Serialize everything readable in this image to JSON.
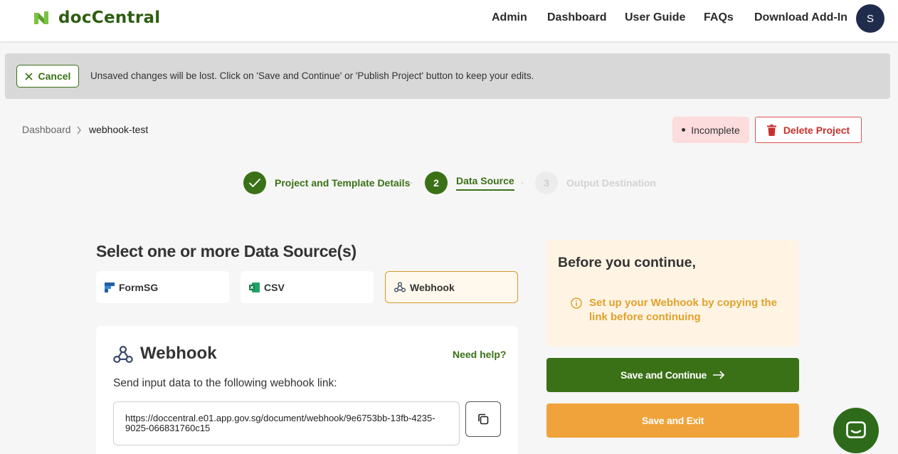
{
  "app": {
    "name": "docCentral",
    "nav": [
      "Admin",
      "Dashboard",
      "User Guide",
      "FAQs",
      "Download Add-In"
    ],
    "user_initial": "S"
  },
  "banner": {
    "cancel_label": "Cancel",
    "message": "Unsaved changes will be lost. Click on 'Save and Continue' or 'Publish Project' button to keep your edits."
  },
  "breadcrumb": {
    "items": [
      "Dashboard",
      "webhook-test"
    ],
    "separator": ">"
  },
  "project": {
    "status": "Incomplete",
    "delete_label": "Delete Project"
  },
  "stepper": {
    "steps": [
      {
        "number": "1",
        "label": "Project and Template Details",
        "state": "done"
      },
      {
        "number": "2",
        "label": "Data Source",
        "state": "active"
      },
      {
        "number": "3",
        "label": "Output Destination",
        "state": "pending"
      }
    ],
    "separator": "-"
  },
  "data_source": {
    "title": "Select one or more Data Source(s)",
    "options": [
      {
        "label": "FormSG",
        "icon": "formsg-icon",
        "selected": false
      },
      {
        "label": "CSV",
        "icon": "excel-icon",
        "selected": false
      },
      {
        "label": "Webhook",
        "icon": "webhook-icon",
        "selected": true
      }
    ]
  },
  "webhook_panel": {
    "title": "Webhook",
    "help_label": "Need help?",
    "description": "Send input data to the following webhook link:",
    "url": "https://doccentral.e01.app.gov.sg/document/webhook/9e6753bb-13fb-4235-9025-066831760c15"
  },
  "sidebar": {
    "title": "Before you continue,",
    "note": "Set up your Webhook by copying the link before continuing",
    "save_continue_label": "Save and Continue",
    "save_exit_label": "Save and Exit"
  },
  "colors": {
    "brand_green": "#3a7116",
    "warning_orange": "#f0a33a",
    "danger_red": "#c9302c"
  }
}
